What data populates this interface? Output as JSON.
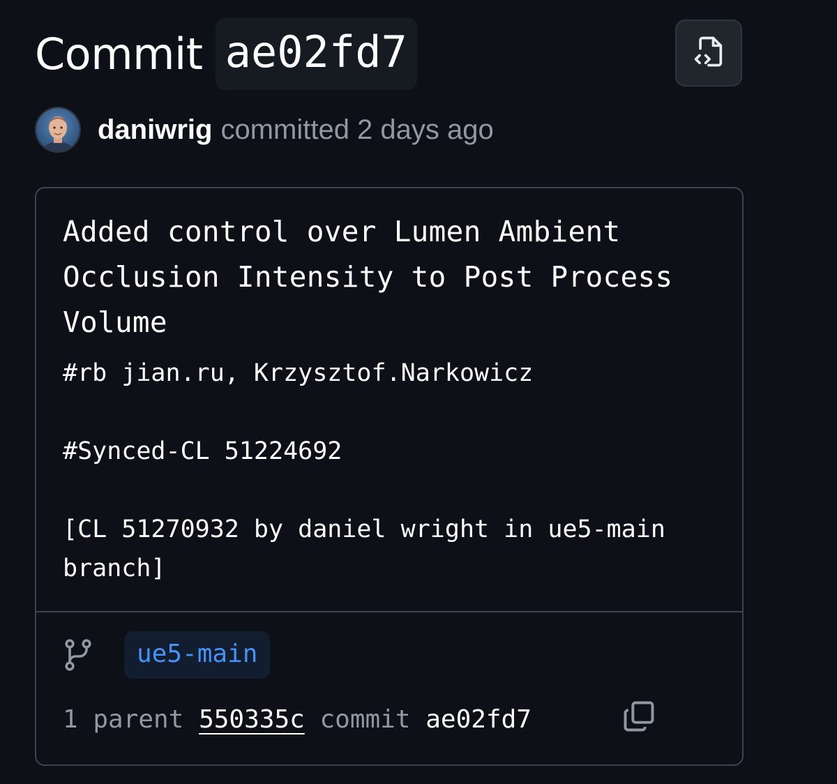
{
  "header": {
    "title_word": "Commit",
    "sha": "ae02fd7",
    "browse_button_icon": "file-code-icon"
  },
  "author": {
    "avatar_icon": "avatar",
    "name": "daniwrig",
    "meta": "committed 2 days ago"
  },
  "commit": {
    "title": "Added control over Lumen Ambient\nOcclusion Intensity to Post Process\nVolume",
    "body": "#rb jian.ru, Krzysztof.Narkowicz\n\n#Synced-CL 51224692\n\n[CL 51270932 by daniel wright in ue5-main\nbranch]",
    "branch_icon": "git-branch-icon",
    "branch": "ue5-main",
    "parent_count_label": "1 parent",
    "parent_sha": "550335c",
    "commit_label": "commit",
    "commit_sha": "ae02fd7",
    "copy_icon": "copy-icon"
  },
  "colors": {
    "background": "#0d1117",
    "border": "#3d444d",
    "muted_text": "#9198a1",
    "link_blue": "#4493f8",
    "branch_tag_bg": "#121d2f"
  }
}
